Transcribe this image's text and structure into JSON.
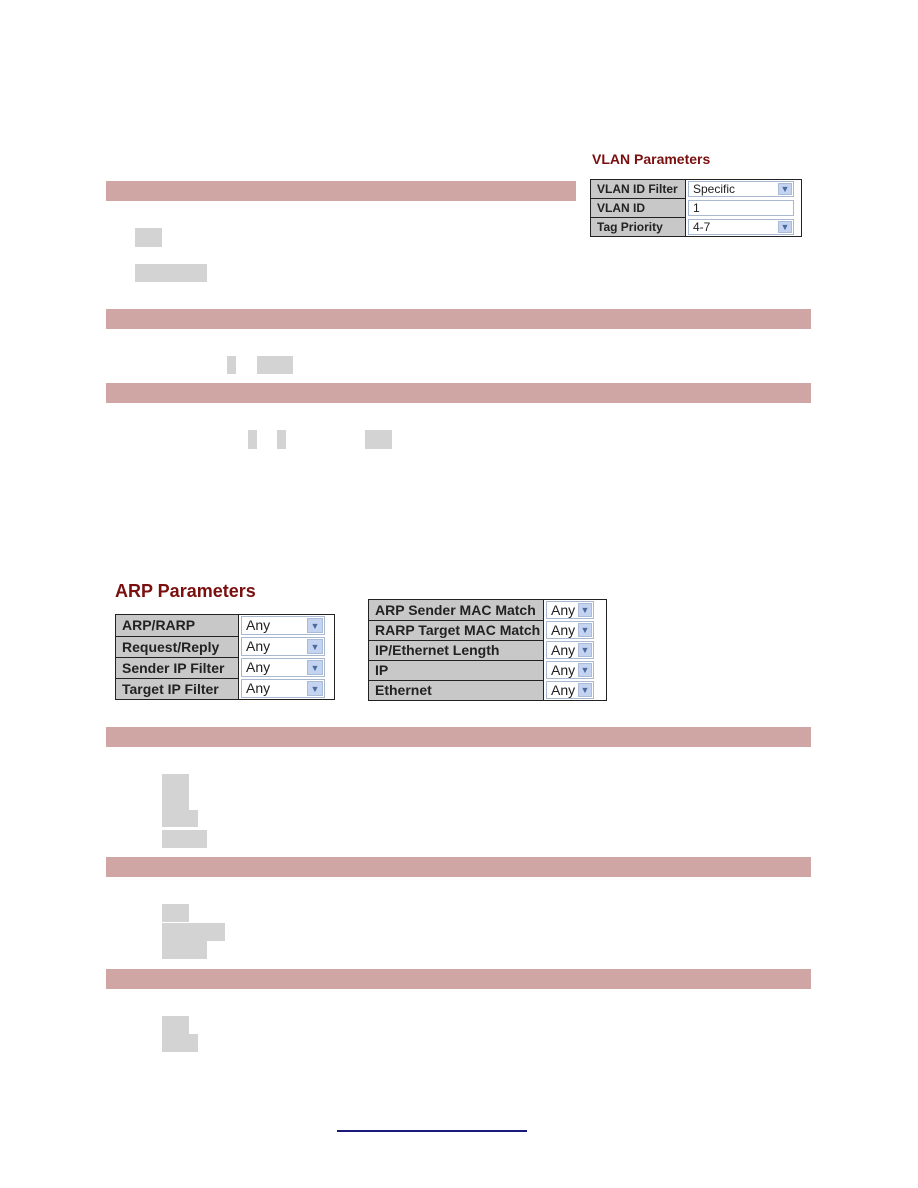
{
  "vlan_parameters": {
    "title": "VLAN Parameters",
    "rows": [
      {
        "label": "VLAN ID Filter",
        "type": "select",
        "value": "Specific"
      },
      {
        "label": "VLAN ID",
        "type": "text",
        "value": "1"
      },
      {
        "label": "Tag Priority",
        "type": "select",
        "value": "4-7"
      }
    ]
  },
  "arp_parameters": {
    "title": "ARP Parameters",
    "left_table": [
      {
        "label": "ARP/RARP",
        "value": "Any"
      },
      {
        "label": "Request/Reply",
        "value": "Any"
      },
      {
        "label": "Sender IP Filter",
        "value": "Any"
      },
      {
        "label": "Target IP Filter",
        "value": "Any"
      }
    ],
    "right_table": [
      {
        "label": "ARP Sender MAC Match",
        "value": "Any"
      },
      {
        "label": "RARP Target MAC Match",
        "value": "Any"
      },
      {
        "label": "IP/Ethernet Length",
        "value": "Any"
      },
      {
        "label": "IP",
        "value": "Any"
      },
      {
        "label": "Ethernet",
        "value": "Any"
      }
    ]
  },
  "icons": {
    "dropdown_arrow": "chevron-down-icon"
  },
  "colors": {
    "section_band": "#cfa6a4",
    "section_title": "#7a0f0f",
    "label_cell": "#c8c8c8",
    "redaction": "#d3d3d3",
    "link": "#1a1a7a"
  }
}
